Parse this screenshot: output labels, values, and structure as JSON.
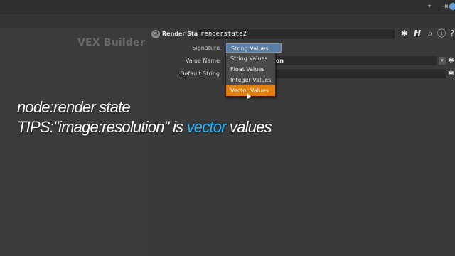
{
  "toolbar": {
    "icons": [
      "tools-icon",
      "tree-icon",
      "notes-icon",
      "grid-icon",
      "network-icon",
      "sticky-icon",
      "image-icon",
      "palette-icon",
      "search-icon"
    ]
  },
  "network": {
    "title": "VEX Builder"
  },
  "node": {
    "type": "Render State",
    "name": "renderstate2"
  },
  "params": {
    "signature_label": "Signature",
    "signature_value": "String Values",
    "value_name_label": "Value Name",
    "value_name_value": "ion",
    "default_string_label": "Default String",
    "default_string_value": ""
  },
  "dropdown": {
    "items": [
      "String Values",
      "Float Values",
      "Integer Values",
      "Vector Values"
    ],
    "selected": "Vector Values"
  },
  "overlay": {
    "line1": "node:render state",
    "line2_pre": "TIPS:\"image:resolution\" is ",
    "line2_hl": "vector",
    "line2_post": " values"
  },
  "colors": {
    "highlight": "#25b6ff",
    "menu_selected": "#e07e10",
    "menu_button": "#5a7ea6"
  }
}
